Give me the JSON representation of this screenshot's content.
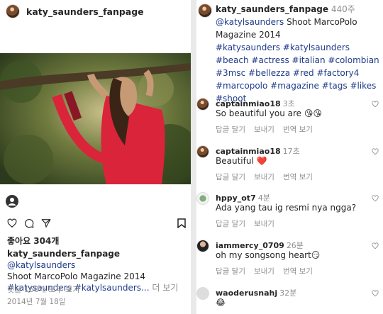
{
  "post": {
    "username": "katy_saunders_fanpage",
    "likes": "좋아요 304개",
    "caption_mention": "@katylsaunders",
    "caption_line2": "Shoot MarcoPolo Magazine 2014",
    "caption_tags": "#katysaunders #katylsaunders...",
    "more_label": "더 보기",
    "view_comments": "댓글 160개 모두 보기",
    "date": "2014년 7월 18일"
  },
  "caption_panel": {
    "username": "katy_saunders_fanpage",
    "time": "440주",
    "mention": "@katylsaunders",
    "text": "Shoot MarcoPolo Magazine 2014",
    "hashtags": "#katysaunders #katylsaunders #beach #actress #italian #colombian #3msc #bellezza #red #factory4 #marcopolo #magazine #tags #likes #shoot"
  },
  "comments": [
    {
      "user": "captainmiao18",
      "time": "3초",
      "text": "So beautiful you are 😘😘",
      "meta": [
        "답글 달기",
        "보내기",
        "번역 보기"
      ]
    },
    {
      "user": "captainmiao18",
      "time": "17초",
      "text": "Beautiful ❤️",
      "meta": [
        "답글 달기",
        "보내기",
        "번역 보기"
      ]
    },
    {
      "user": "hppy_ot7",
      "time": "4분",
      "text": "Ada yang tau ig resmi nya ngga?",
      "meta": [
        "답글 달기",
        "보내기"
      ]
    },
    {
      "user": "iammercy_0709",
      "time": "26분",
      "text": "oh my songsong heart😏",
      "meta": [
        "답글 달기",
        "보내기",
        "번역 보기"
      ]
    },
    {
      "user": "waoderusnahj",
      "time": "32분",
      "text": "😂",
      "meta": []
    }
  ],
  "icons": [
    "heart-icon",
    "comment-icon",
    "share-icon",
    "bookmark-icon",
    "person-tag-icon"
  ],
  "colors": {
    "link_blue": "#1f3b8a",
    "muted": "#8e8e8e"
  }
}
